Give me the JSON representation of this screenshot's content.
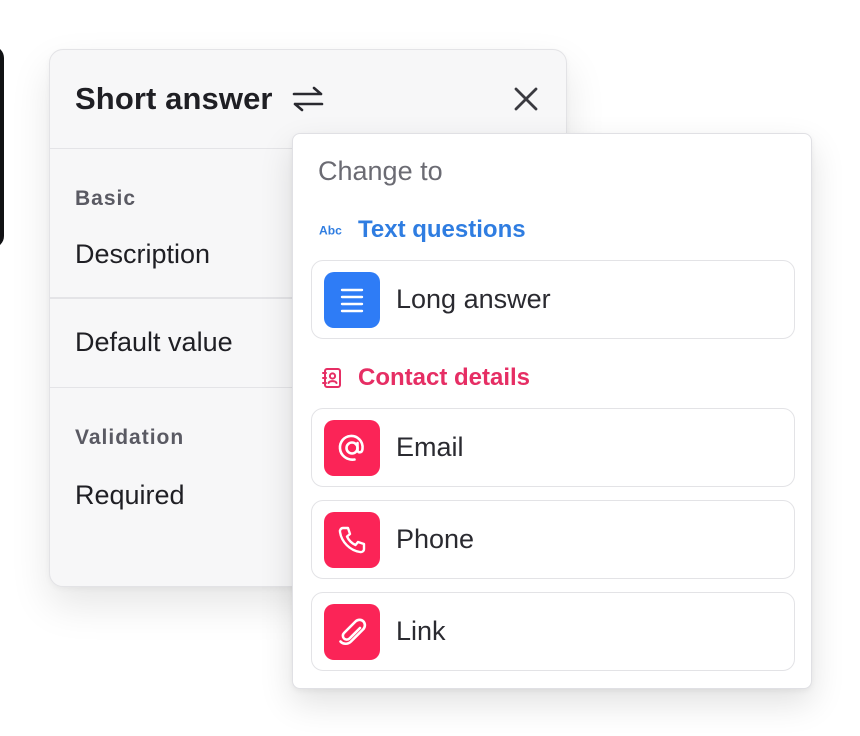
{
  "panel": {
    "title": "Short answer",
    "sections": {
      "basic": "Basic",
      "description": "Description",
      "default_value": "Default value",
      "validation": "Validation",
      "required": "Required"
    }
  },
  "dropdown": {
    "title": "Change to",
    "groups": [
      {
        "label": "Text questions",
        "icon": "abc-icon",
        "color": "#2f7de1",
        "options": [
          {
            "label": "Long answer",
            "icon": "long-answer-icon",
            "color": "#2e7cf6"
          }
        ]
      },
      {
        "label": "Contact details",
        "icon": "contact-book-icon",
        "color": "#e62e64",
        "options": [
          {
            "label": "Email",
            "icon": "at-sign-icon",
            "color": "#fb2457"
          },
          {
            "label": "Phone",
            "icon": "phone-icon",
            "color": "#fb2457"
          },
          {
            "label": "Link",
            "icon": "paperclip-icon",
            "color": "#fb2457"
          }
        ]
      }
    ]
  },
  "colors": {
    "blue": "#2e7cf6",
    "pink": "#fb2457",
    "panel_bg": "#f7f7f8"
  }
}
